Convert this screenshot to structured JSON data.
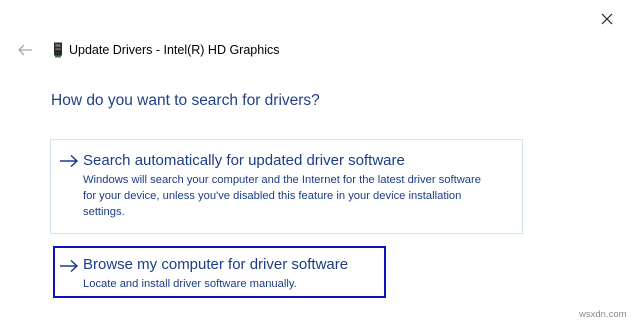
{
  "header": {
    "title": "Update Drivers - Intel(R) HD Graphics",
    "back_icon": "back-arrow-icon",
    "device_icon": "graphics-card-icon",
    "close_icon": "close-icon"
  },
  "main": {
    "heading": "How do you want to search for drivers?",
    "options": [
      {
        "title": "Search automatically for updated driver software",
        "description_lines": [
          "Windows will search your computer and the Internet for the latest driver software",
          "for your device, unless you've disabled this feature in your device installation",
          "settings."
        ],
        "icon": "right-arrow-icon"
      },
      {
        "title": "Browse my computer for driver software",
        "description_lines": [
          "Locate and install driver software manually."
        ],
        "icon": "right-arrow-icon",
        "highlighted": true
      }
    ]
  },
  "watermark": "wsxdn.com",
  "colors": {
    "link_blue": "#1b3c87",
    "highlight_border": "#0d14b8",
    "option_border": "#cfe4f3",
    "background": "#ffffff"
  }
}
